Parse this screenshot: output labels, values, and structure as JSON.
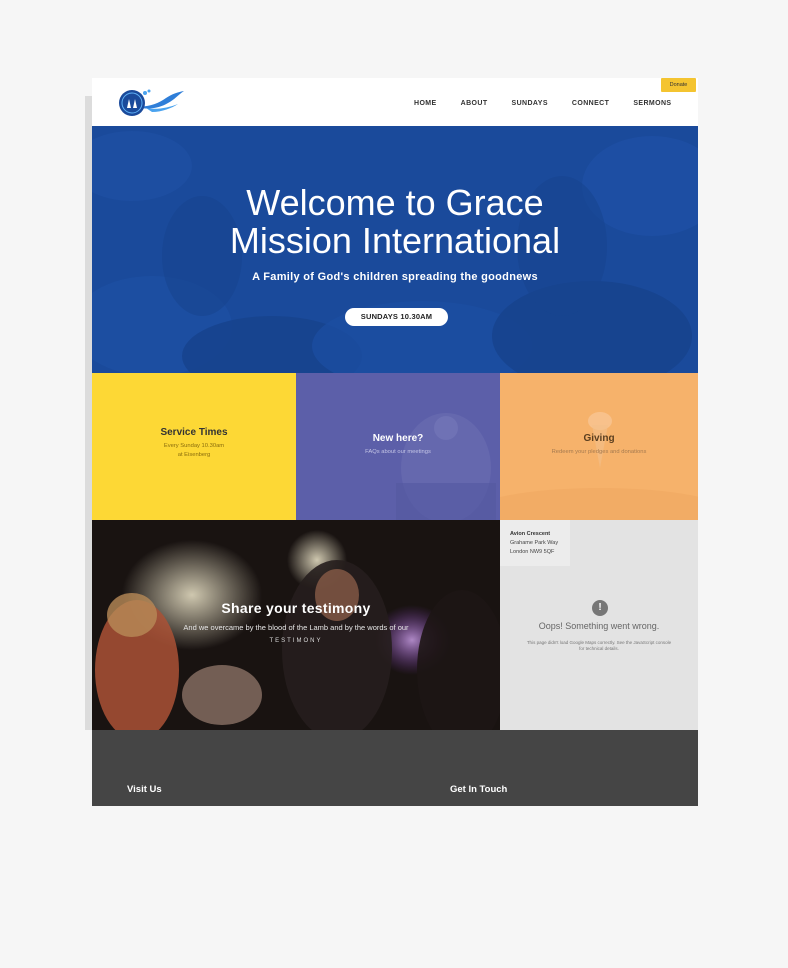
{
  "header": {
    "donate_label": "Donate",
    "nav": [
      "HOME",
      "ABOUT",
      "SUNDAYS",
      "CONNECT",
      "SERMONS"
    ]
  },
  "hero": {
    "title_line1": "Welcome to Grace",
    "title_line2": "Mission International",
    "subtitle": "A Family of God's children spreading the goodnews",
    "button": "SUNDAYS 10.30AM"
  },
  "tiles": {
    "service": {
      "title": "Service Times",
      "line1": "Every Sunday 10.30am",
      "line2": "at Eisenberg"
    },
    "new_here": {
      "title": "New here?",
      "text": "FAQs about our meetings"
    },
    "giving": {
      "title": "Giving",
      "text": "Redeem your pledges and donations"
    }
  },
  "testimony": {
    "title": "Share your testimony",
    "text": "And we overcame by the blood of the Lamb and by the words of our",
    "link": "TESTIMONY"
  },
  "map": {
    "address": [
      "Avion Crescent",
      "Grahame Park Way",
      "London NW9 5QF"
    ],
    "error_title": "Oops! Something went wrong.",
    "error_text": "This page didn't load Google Maps correctly. See the JavaScript console for technical details."
  },
  "footer": {
    "visit": "Visit Us",
    "touch": "Get In Touch"
  },
  "colors": {
    "hero_blue": "#1a4a9b",
    "yellow": "#fdd835",
    "purple": "#5c5fa9",
    "orange": "#f6b26b",
    "footer": "#454545",
    "donate": "#f4c430"
  }
}
